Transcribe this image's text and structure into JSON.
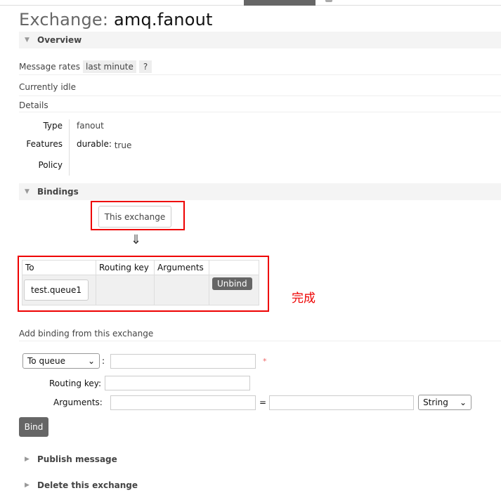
{
  "title_prefix": "Exchange: ",
  "title_name": "amq.fanout",
  "sections": {
    "overview": "Overview",
    "bindings": "Bindings",
    "publish": "Publish message",
    "delete": "Delete this exchange"
  },
  "overview": {
    "message_rates_label": "Message rates",
    "rate_period": "last minute",
    "help": "?",
    "idle": "Currently idle",
    "details": "Details",
    "type_label": "Type",
    "type_value": "fanout",
    "features_label": "Features",
    "durable_label": "durable:",
    "durable_value": "true",
    "policy_label": "Policy"
  },
  "bindings": {
    "this_exchange": "This exchange",
    "arrow": "⇓",
    "headers": [
      "To",
      "Routing key",
      "Arguments",
      ""
    ],
    "rows": [
      {
        "to": "test.queue1",
        "routing_key": "",
        "arguments": "",
        "action": "Unbind"
      }
    ],
    "annotation": "完成"
  },
  "add_binding": {
    "label": "Add binding from this exchange",
    "destination_type": "To queue",
    "routing_key_label": "Routing key:",
    "arguments_label": "Arguments:",
    "equals": "=",
    "arg_type": "String",
    "required_marker": "*",
    "bind_button": "Bind"
  },
  "colors": {
    "annotation_red": "#e00000",
    "button_gray": "#666666"
  }
}
